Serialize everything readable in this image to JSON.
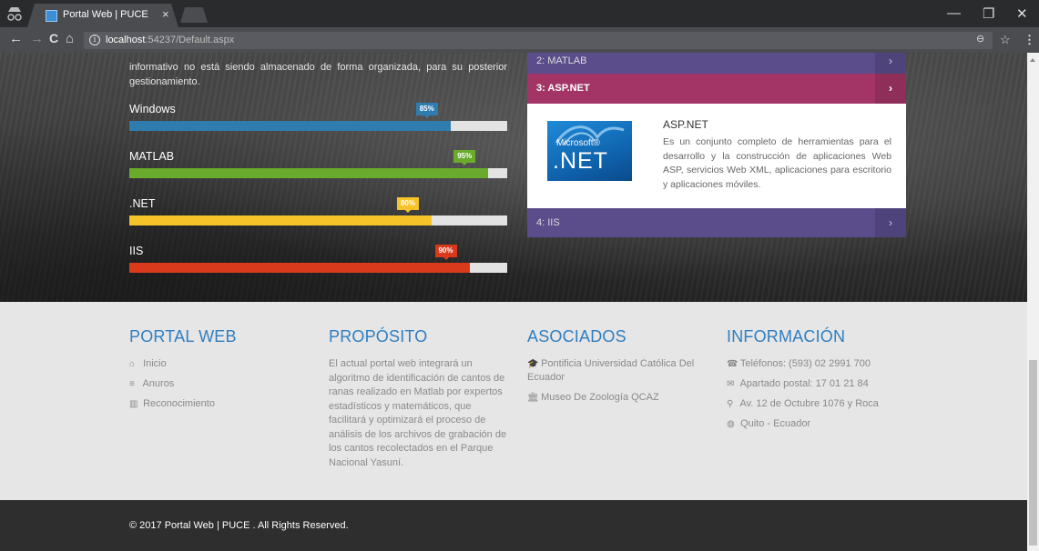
{
  "browser": {
    "tab_title": "Portal Web | PUCE",
    "tab_close": "×",
    "url_host": "localhost",
    "url_rest": ":54237/Default.aspx",
    "controls": {
      "back": "←",
      "forward": "→",
      "reload": "C",
      "home": "⌂",
      "zoom": "🔍",
      "star": "☆",
      "menu": "⋮",
      "minimize": "—",
      "restore": "❐",
      "close": "✕"
    }
  },
  "intro_text": "informativo no está siendo almacenado de forma organizada, para su posterior gestionamiento.",
  "skills": [
    {
      "label": "Windows",
      "percent_text": "85%",
      "value": 85,
      "color": "#2e7dae"
    },
    {
      "label": "MATLAB",
      "percent_text": "95%",
      "value": 95,
      "color": "#6aaa2c"
    },
    {
      "label": ".NET",
      "percent_text": "80%",
      "value": 80,
      "color": "#f6c429"
    },
    {
      "label": "IIS",
      "percent_text": "90%",
      "value": 90,
      "color": "#d93a1c"
    }
  ],
  "accordion": {
    "items": [
      {
        "label": "2: MATLAB",
        "chevron": "›"
      },
      {
        "label": "3: ASP.NET",
        "chevron": "›"
      },
      {
        "label": "4: IIS",
        "chevron": "›"
      }
    ],
    "panel": {
      "logo_brand": "Microsoft®",
      "logo_text": ".NET",
      "title": "ASP.NET",
      "text": "Es un conjunto completo de herramientas para el desarrollo y la construcción de aplicaciones Web ASP, servicios Web XML, aplicaciones para escritorio y aplicaciones móviles."
    }
  },
  "footer": {
    "portal": {
      "title": "PORTAL WEB",
      "links": [
        {
          "icon": "home-icon",
          "glyph": "⌂",
          "label": "Inicio"
        },
        {
          "icon": "database-icon",
          "glyph": "≡",
          "label": "Anuros"
        },
        {
          "icon": "bar-chart-icon",
          "glyph": "▥",
          "label": "Reconocimiento"
        }
      ]
    },
    "proposito": {
      "title": "PROPÓSITO",
      "text": "El actual portal web integrará un algoritmo de identificación de cantos de ranas realizado en Matlab por expertos estadísticos y matemáticos, que facilitará y optimizará el proceso de análisis de los archivos de grabación de los cantos recolectados en el Parque Nacional Yasuní."
    },
    "asociados": {
      "title": "ASOCIADOS",
      "items": [
        {
          "icon": "graduation-cap-icon",
          "glyph": "🎓",
          "label": "Pontificia Universidad Católica Del Ecuador"
        },
        {
          "icon": "institution-icon",
          "glyph": "🏛",
          "label": "Museo De Zoología QCAZ"
        }
      ]
    },
    "informacion": {
      "title": "INFORMACIÓN",
      "items": [
        {
          "icon": "phone-icon",
          "glyph": "☎",
          "label": "Teléfonos: (593) 02 2991 700"
        },
        {
          "icon": "envelope-icon",
          "glyph": "✉",
          "label": "Apartado postal: 17 01 21 84"
        },
        {
          "icon": "map-marker-icon",
          "glyph": "⚲",
          "label": "Av. 12 de Octubre 1076 y Roca"
        },
        {
          "icon": "globe-icon",
          "glyph": "◍",
          "label": "Quito - Ecuador"
        }
      ]
    }
  },
  "copyright": "© 2017 Portal Web | PUCE . All Rights Reserved."
}
